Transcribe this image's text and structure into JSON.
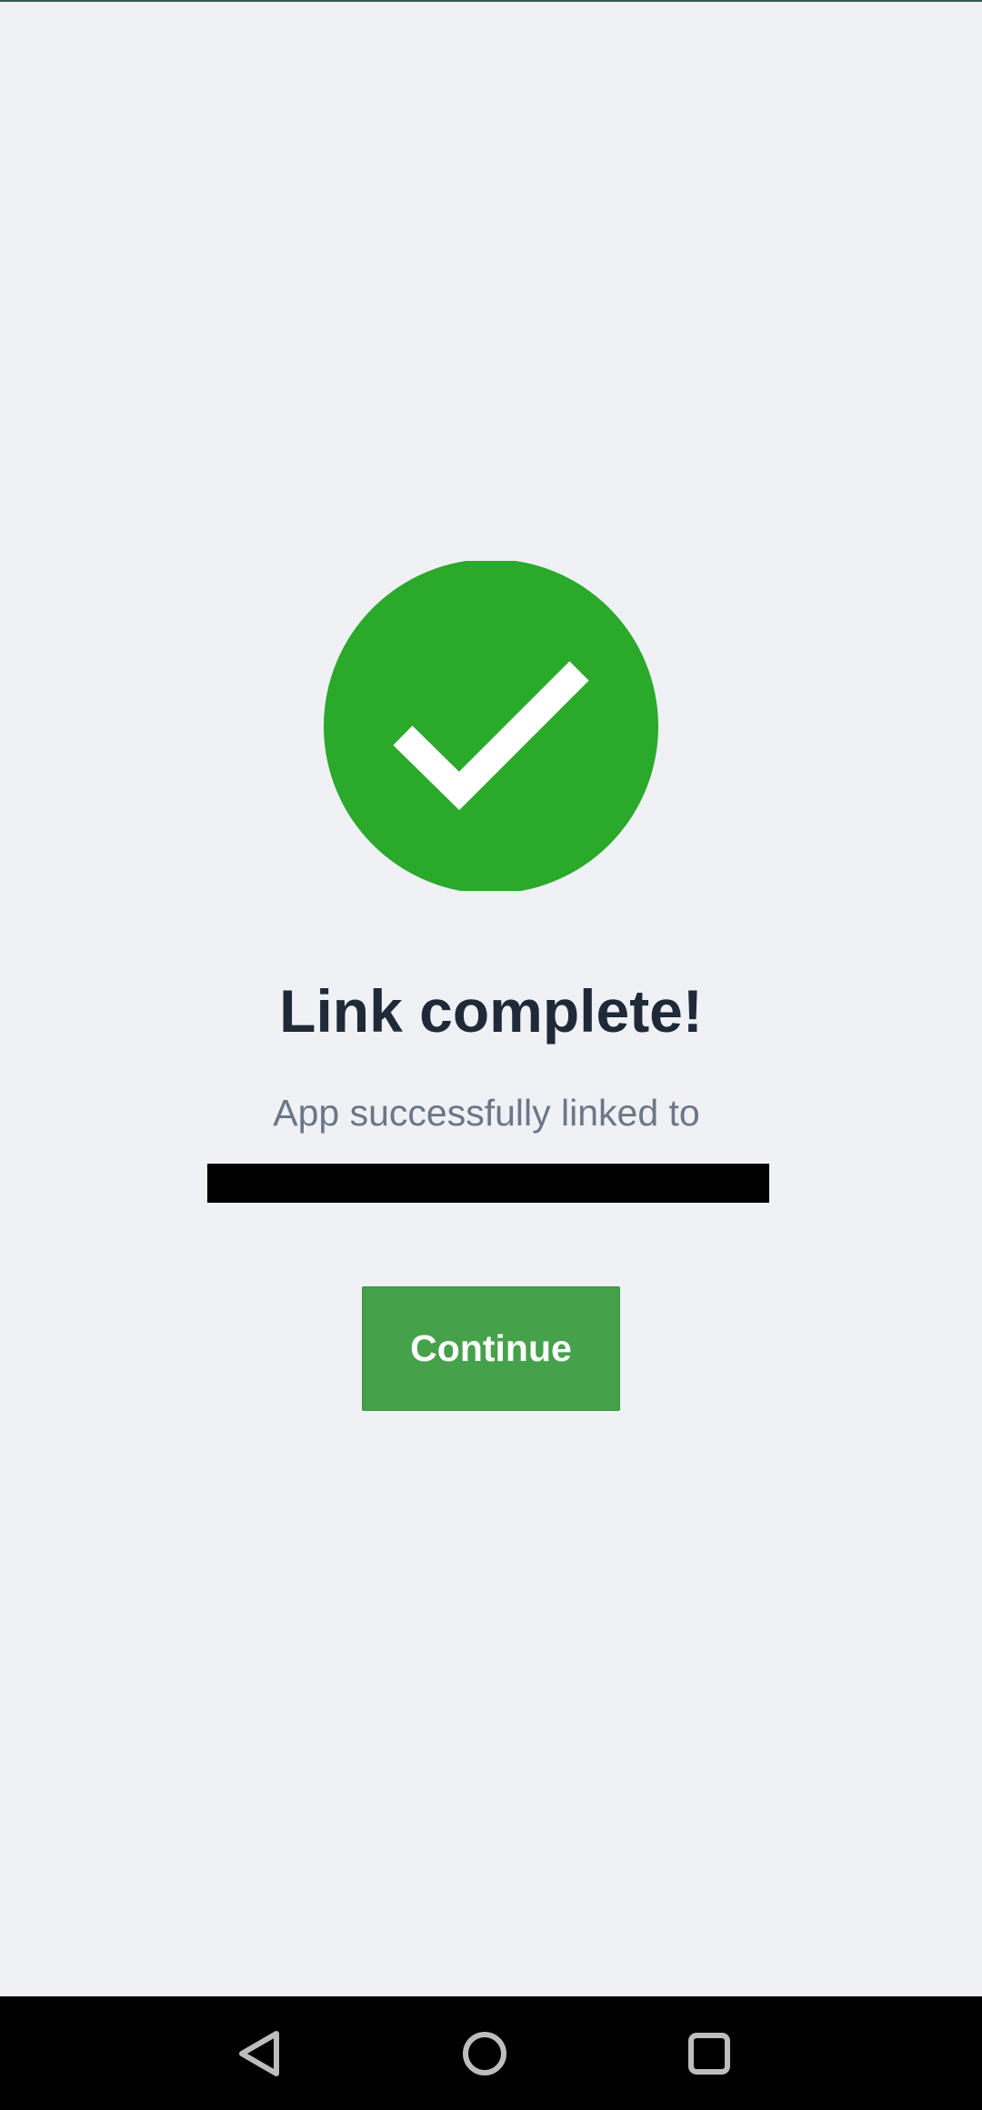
{
  "colors": {
    "background": "#eff1f5",
    "success_green": "#2aa92b",
    "button_green": "#45a14a",
    "title_text": "#1f2937",
    "subtitle_text": "#6b7787",
    "nav_bar": "#000000",
    "nav_icon": "#bdbdbd"
  },
  "status": {
    "icon": "check-circle-icon",
    "title": "Link complete!",
    "message": "App successfully linked to"
  },
  "actions": {
    "continue_label": "Continue"
  },
  "navbar": {
    "back_icon": "back-triangle-icon",
    "home_icon": "home-circle-icon",
    "recents_icon": "recents-square-icon"
  }
}
